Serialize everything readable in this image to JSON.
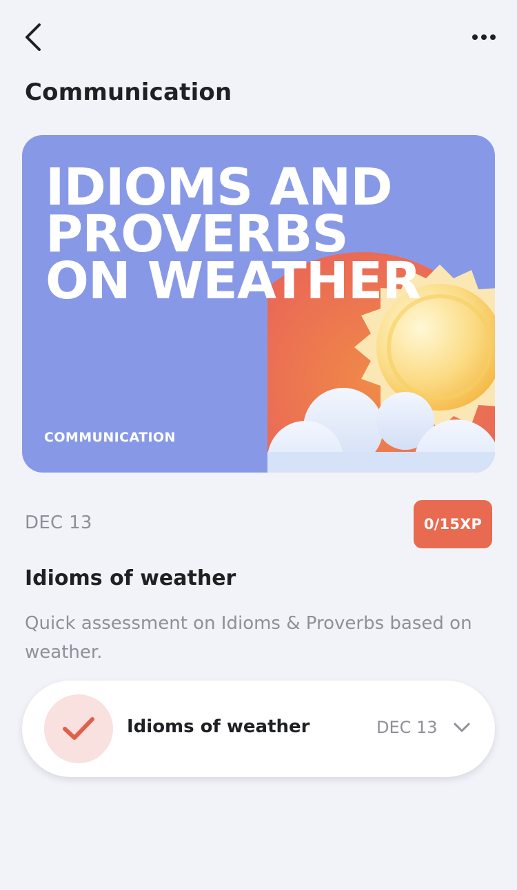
{
  "header": {
    "back_icon": "chevron-left-icon",
    "more_icon": "more-horizontal-icon",
    "title": "Communication"
  },
  "hero": {
    "title_lines": [
      "IDIOMS AND",
      "PROVERBS",
      "ON WEATHER"
    ],
    "category": "COMMUNICATION",
    "illustration": "sun-behind-cloud",
    "background_color": "#8799e6"
  },
  "meta": {
    "date": "DEC 13",
    "xp": "0/15XP",
    "xp_color": "#e86a50"
  },
  "lesson": {
    "title": "Idioms of weather",
    "description": "Quick assessment on Idioms & Proverbs based on weather."
  },
  "item": {
    "status_icon": "checkmark-icon",
    "title": "Idioms of weather",
    "date": "DEC 13",
    "expand_icon": "chevron-down-icon"
  }
}
